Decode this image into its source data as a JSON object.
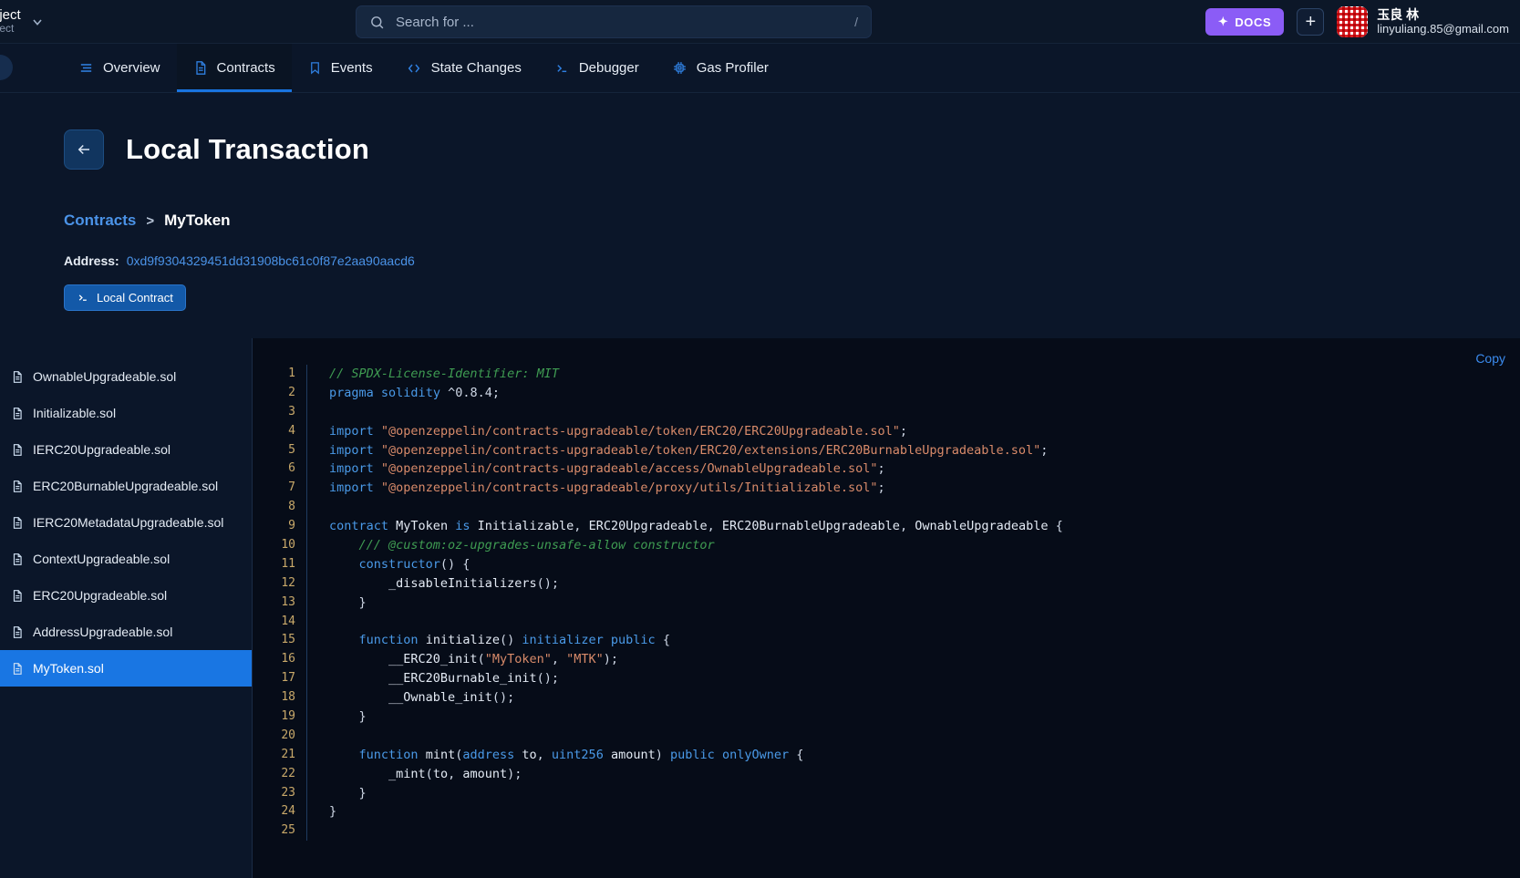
{
  "header": {
    "project_name": "roject",
    "project_sub": "roject",
    "chevron_icon": "chevron-down-icon",
    "search": {
      "placeholder": "Search for ...",
      "value": "",
      "icon": "search-icon",
      "shortcut": "/"
    },
    "docs_label": "DOCS",
    "docs_icon": "sparkle-icon",
    "docs_color": "#8b5cf6",
    "add_label": "+",
    "user": {
      "name": "玉良 林",
      "email": "linyuliang.85@gmail.com"
    }
  },
  "nav": {
    "tabs": [
      {
        "label": "Overview",
        "icon": "list-icon",
        "active": false
      },
      {
        "label": "Contracts",
        "icon": "document-icon",
        "active": true
      },
      {
        "label": "Events",
        "icon": "bookmark-icon",
        "active": false
      },
      {
        "label": "State Changes",
        "icon": "code-icon",
        "active": false
      },
      {
        "label": "Debugger",
        "icon": "terminal-icon",
        "active": false
      },
      {
        "label": "Gas Profiler",
        "icon": "chip-icon",
        "active": false
      }
    ],
    "active_underline_color": "#1974e0"
  },
  "page": {
    "back_icon": "arrow-left-icon",
    "title": "Local Transaction",
    "breadcrumb": {
      "root": "Contracts",
      "separator": ">",
      "current": "MyToken"
    },
    "address_label": "Address:",
    "address_value": "0xd9f9304329451dd31908bc61c0f87e2aa90aacd6",
    "badge_label": "Local Contract",
    "badge_icon": "terminal-icon"
  },
  "files": {
    "items": [
      {
        "name": "OwnableUpgradeable.sol",
        "selected": false
      },
      {
        "name": "Initializable.sol",
        "selected": false
      },
      {
        "name": "IERC20Upgradeable.sol",
        "selected": false
      },
      {
        "name": "ERC20BurnableUpgradeable.sol",
        "selected": false
      },
      {
        "name": "IERC20MetadataUpgradeable.sol",
        "selected": false
      },
      {
        "name": "ContextUpgradeable.sol",
        "selected": false
      },
      {
        "name": "ERC20Upgradeable.sol",
        "selected": false
      },
      {
        "name": "AddressUpgradeable.sol",
        "selected": false
      },
      {
        "name": "MyToken.sol",
        "selected": true
      }
    ],
    "file_icon": "file-icon"
  },
  "code": {
    "copy_label": "Copy",
    "language": "solidity",
    "line_numbers": [
      1,
      2,
      3,
      4,
      5,
      6,
      7,
      8,
      9,
      10,
      11,
      12,
      13,
      14,
      15,
      16,
      17,
      18,
      19,
      20,
      21,
      22,
      23,
      24,
      25
    ],
    "lines": [
      "// SPDX-License-Identifier: MIT",
      "pragma solidity ^0.8.4;",
      "",
      "import \"@openzeppelin/contracts-upgradeable/token/ERC20/ERC20Upgradeable.sol\";",
      "import \"@openzeppelin/contracts-upgradeable/token/ERC20/extensions/ERC20BurnableUpgradeable.sol\";",
      "import \"@openzeppelin/contracts-upgradeable/access/OwnableUpgradeable.sol\";",
      "import \"@openzeppelin/contracts-upgradeable/proxy/utils/Initializable.sol\";",
      "",
      "contract MyToken is Initializable, ERC20Upgradeable, ERC20BurnableUpgradeable, OwnableUpgradeable {",
      "    /// @custom:oz-upgrades-unsafe-allow constructor",
      "    constructor() {",
      "        _disableInitializers();",
      "    }",
      "",
      "    function initialize() initializer public {",
      "        __ERC20_init(\"MyToken\", \"MTK\");",
      "        __ERC20Burnable_init();",
      "        __Ownable_init();",
      "    }",
      "",
      "    function mint(address to, uint256 amount) public onlyOwner {",
      "        _mint(to, amount);",
      "    }",
      "}",
      ""
    ]
  }
}
